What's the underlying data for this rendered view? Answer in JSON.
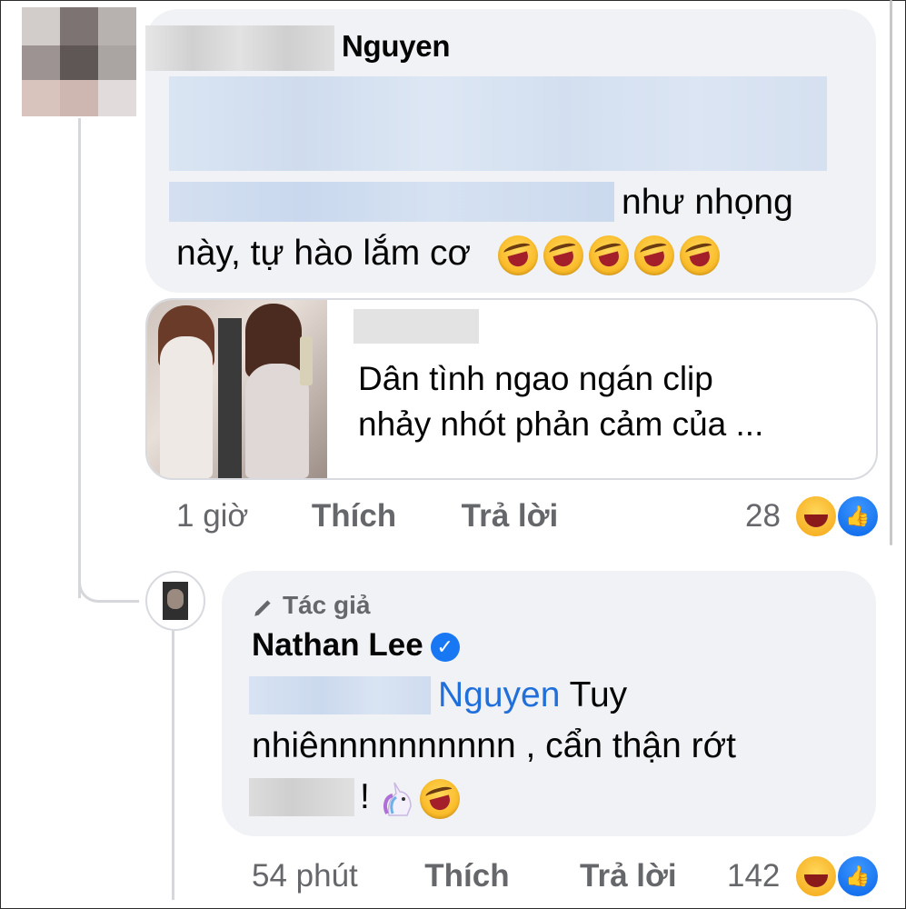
{
  "comment1": {
    "author": "Nguyen",
    "text_line2_tail": "như nhọng",
    "text_line3": "này, tự hào lắm cơ",
    "emoji_count": 5,
    "link_preview": {
      "title_line1": "Dân tình ngao ngán clip",
      "title_line2": "nhảy nhót phản cảm của ..."
    },
    "actions": {
      "time": "1 giờ",
      "like": "Thích",
      "reply": "Trả lời"
    },
    "reaction_count": "28"
  },
  "comment2": {
    "badge": "Tác giả",
    "author": "Nathan Lee",
    "mention": "Nguyen",
    "text_line1_tail": "Tuy",
    "text_line2": "nhiênnnnnnnnnn , cẩn thận rớt",
    "text_line3_punct": "!",
    "actions": {
      "time": "54 phút",
      "like": "Thích",
      "reply": "Trả lời"
    },
    "reaction_count": "142"
  },
  "icons": {
    "verified": "verified-check-icon",
    "pencil": "pencil-icon",
    "haha": "haha-reaction-icon",
    "like": "like-reaction-icon",
    "unicorn": "unicorn-emoji-icon"
  },
  "colors": {
    "bubble": "#f0f2f5",
    "mention": "#216fdb",
    "meta_text": "#65676b",
    "verified": "#1877f2"
  }
}
